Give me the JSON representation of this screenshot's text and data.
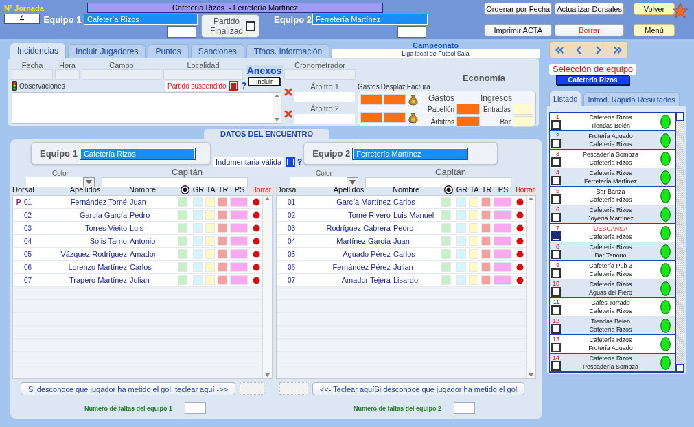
{
  "header": {
    "jornada_label": "Nº Jornada",
    "jornada": "4",
    "team1_label": "Equipo 1",
    "team1": "Cafetería Rizos",
    "team2_label": "Equipo 2",
    "team2": "Ferretería Martínez",
    "title": "Cafetería Rizos  - Ferretería Martínez",
    "finalized": {
      "label": "Partido Finalizad",
      "checked": false
    },
    "buttons": [
      {
        "label": "Ordenar por Fecha",
        "kind": "plain"
      },
      {
        "label": "Actualizar Dorsales",
        "kind": "plain"
      },
      {
        "label": "Volver",
        "kind": "yellow"
      },
      {
        "label": "Imprimir ACTA",
        "kind": "plain"
      },
      {
        "label": "Borrar",
        "kind": "danger"
      },
      {
        "label": "Menú",
        "kind": "yellow"
      }
    ]
  },
  "tabs": [
    {
      "label": "Incidencias",
      "selected": true
    },
    {
      "label": "Incluir Jugadores",
      "selected": false
    },
    {
      "label": "Puntos",
      "selected": false
    },
    {
      "label": "Sanciones",
      "selected": false
    },
    {
      "label": "Tfnos. Información",
      "selected": false
    }
  ],
  "campeonato": {
    "label": "Campeonato",
    "value": "Liga local de Fútbol Sala"
  },
  "incidencias": {
    "fields": [
      "Fecha",
      "Hora",
      "Campo",
      "Localidad"
    ],
    "anexos": "Anexos",
    "include_button": "Incluir",
    "cronometrador": "Cronometrador",
    "observaciones": "Observaciones",
    "suspended": {
      "label": "Partido suspendido",
      "checked": true
    },
    "help": "?",
    "referees": [
      "Árbitro 1",
      "Árbitro 2"
    ],
    "economy": {
      "title": "Economía",
      "columns": [
        "Gastos",
        "Desplaz",
        "Factura"
      ],
      "gastos": "Gastos",
      "ingresos": "Ingresos",
      "rows": [
        {
          "gasto": "Pabellón",
          "ingreso": "Entradas"
        },
        {
          "gasto": "Árbitros",
          "ingreso": "Bar"
        }
      ]
    }
  },
  "match": {
    "title": "DATOS DEL ENCUENTRO",
    "uniform": {
      "label": "Indumentaria válida",
      "checked": true
    },
    "help": "?",
    "teams": [
      {
        "label": "Equipo 1",
        "name": "Cafetería Rizos",
        "color_label": "Color",
        "captain_label": "Capitán",
        "columns": [
          "Dorsal",
          "Apellidos",
          "Nombre",
          "GR",
          "TA",
          "TR",
          "PS",
          "Borrar"
        ],
        "players": [
          {
            "marker": "P",
            "dorsal": "01",
            "surname": "Fernández Tomé",
            "name": "Juan"
          },
          {
            "dorsal": "02",
            "surname": "García García",
            "name": "Pedro"
          },
          {
            "dorsal": "03",
            "surname": "Torres Vieito",
            "name": "Luis"
          },
          {
            "dorsal": "04",
            "surname": "Solis Tarrio",
            "name": "Antonio"
          },
          {
            "dorsal": "05",
            "surname": "Vázquez Rodríguez",
            "name": "Amador"
          },
          {
            "dorsal": "06",
            "surname": "Lorenzo Martínez",
            "name": "Carlos"
          },
          {
            "dorsal": "07",
            "surname": "Trapero Martínez",
            "name": "Julian"
          }
        ],
        "goal_button": "Si desconoce que jugador ha metido el gol, teclear aquí ->>",
        "fouls_label": "Número de faltas del equipo 1"
      },
      {
        "label": "Equipo 2",
        "name": "Ferretería Martínez",
        "color_label": "Color",
        "captain_label": "Capitán",
        "columns": [
          "Dorsal",
          "Apellidos",
          "Nombre",
          "GR",
          "TA",
          "TR",
          "PS",
          "Borrar"
        ],
        "players": [
          {
            "dorsal": "01",
            "surname": "García Martínez",
            "name": "Carlos"
          },
          {
            "dorsal": "02",
            "surname": "Tomé Rivero",
            "name": "Luis Manuel"
          },
          {
            "dorsal": "03",
            "surname": "Rodríguez Cabrera",
            "name": "Pedro"
          },
          {
            "dorsal": "04",
            "surname": "Martínez García",
            "name": "Juan"
          },
          {
            "dorsal": "05",
            "surname": "Aguado Pérez",
            "name": "Carlos"
          },
          {
            "dorsal": "06",
            "surname": "Fernández Pérez",
            "name": "Julian"
          },
          {
            "dorsal": "07",
            "surname": "Amador Tejera",
            "name": "Lisardo"
          }
        ],
        "goal_button": "<<- Teclear aquíSi desconoce que jugador ha metido el gol",
        "fouls_label": "Número de faltas del equipo 2"
      }
    ]
  },
  "sidebar": {
    "selection_label": "Selección de equipo",
    "selected_team": "Cafetería Rizos",
    "tabs": [
      {
        "label": "Listado",
        "selected": true
      },
      {
        "label": "Introd. Rápida Resultados",
        "selected": false
      }
    ],
    "matches": [
      {
        "number": "1",
        "home": "Cafetería Rizos",
        "away": "Tiendas Belén",
        "checked": false,
        "bye": false
      },
      {
        "number": "2",
        "home": "Frutería Aguado",
        "away": "Cafetería Rizos",
        "checked": false,
        "bye": false
      },
      {
        "number": "3",
        "home": "Pescadería Somoza",
        "away": "Cafetería Rizos",
        "checked": false,
        "bye": false
      },
      {
        "number": "4",
        "home": "Cafetería Rizos",
        "away": "Ferretería Martínez",
        "checked": false,
        "bye": false
      },
      {
        "number": "5",
        "home": "Bar Banza",
        "away": "Cafetería Rizos",
        "checked": false,
        "bye": false
      },
      {
        "number": "6",
        "home": "Cafetería Rizos",
        "away": "Joyería Martínez",
        "checked": false,
        "bye": false
      },
      {
        "number": "7",
        "home": "DESCANSA",
        "away": "Cafetería Rizos",
        "checked": true,
        "bye": true
      },
      {
        "number": "8",
        "home": "Cafetería Rizos",
        "away": "Bar Tenorio",
        "checked": false,
        "bye": false
      },
      {
        "number": "9",
        "home": "Cafetería Pub 3",
        "away": "Cafetería Rizos",
        "checked": false,
        "bye": false
      },
      {
        "number": "10",
        "home": "Cafetería Rizos",
        "away": "Aguas del Fiero",
        "checked": false,
        "bye": false
      },
      {
        "number": "11",
        "home": "Cafés Torrado",
        "away": "Cafetería Rizos",
        "checked": false,
        "bye": false
      },
      {
        "number": "12",
        "home": "Tiendas Belén",
        "away": "Cafetería Rizos",
        "checked": false,
        "bye": false
      },
      {
        "number": "13",
        "home": "Cafetería Rizos",
        "away": "Frutería Aguado",
        "checked": false,
        "bye": false
      },
      {
        "number": "14",
        "home": "Cafetería Rizos",
        "away": "Pescadería Somoza",
        "checked": false,
        "bye": false
      }
    ]
  }
}
